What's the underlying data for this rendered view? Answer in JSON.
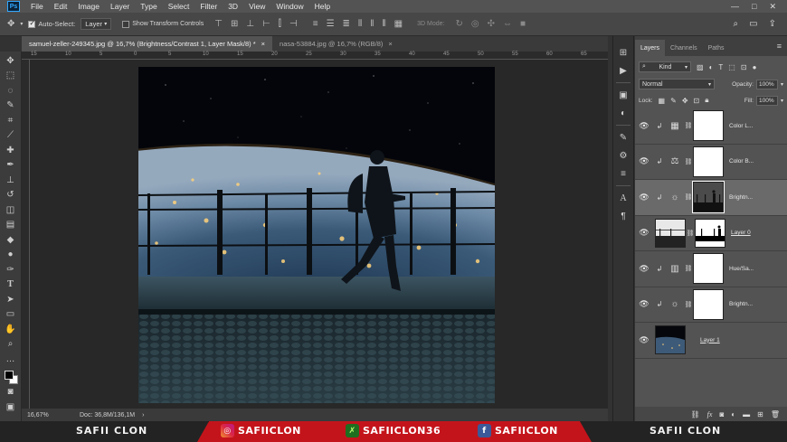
{
  "app": {
    "logo": "Ps"
  },
  "menu": [
    "File",
    "Edit",
    "Image",
    "Layer",
    "Type",
    "Select",
    "Filter",
    "3D",
    "View",
    "Window",
    "Help"
  ],
  "window_controls": [
    "—",
    "□",
    "✕"
  ],
  "options_bar": {
    "auto_select_label": "Auto-Select:",
    "auto_select_target": "Layer",
    "transform_controls_label": "Show Transform Controls",
    "mode_3d_label": "3D Mode:"
  },
  "tabs": [
    {
      "title": "samuel-zeller-249345.jpg @ 16,7% (Brightness/Contrast 1, Layer Mask/8) *",
      "close": "×"
    },
    {
      "title": "nasa-53884.jpg @ 16,7% (RGB/8)",
      "close": "×"
    }
  ],
  "ruler_top": [
    "15",
    "10",
    "5",
    "0",
    "5",
    "10",
    "15",
    "20",
    "25",
    "30",
    "35",
    "40",
    "45",
    "50",
    "55",
    "60",
    "65"
  ],
  "status": {
    "zoom": "16,67%",
    "doc": "Doc: 36,8M/136,1M",
    "arrow": "›"
  },
  "layers_panel": {
    "tabs": [
      "Layers",
      "Channels",
      "Paths"
    ],
    "kind_label": "Kind",
    "blend_mode": "Normal",
    "opacity_label": "Opacity:",
    "opacity_value": "100%",
    "lock_label": "Lock:",
    "fill_label": "Fill:",
    "fill_value": "100%",
    "layers": [
      {
        "name": "Color L...",
        "kind": "adjustment",
        "icon": "grid-icon",
        "selected": false
      },
      {
        "name": "Color B...",
        "kind": "adjustment",
        "icon": "balance-icon",
        "selected": false
      },
      {
        "name": "Brightn...",
        "kind": "adjustment",
        "icon": "sun-icon",
        "selected": true
      },
      {
        "name": "Layer 0",
        "kind": "pixel-mask",
        "selected": false
      },
      {
        "name": "Hue/Sa...",
        "kind": "adjustment",
        "icon": "hue-icon",
        "selected": false
      },
      {
        "name": "Brightn...",
        "kind": "adjustment",
        "icon": "sun-icon",
        "selected": false
      },
      {
        "name": "Layer 1",
        "kind": "pixel",
        "selected": false
      }
    ]
  },
  "banner": {
    "left_name": "SAFII CLON",
    "instagram": "SAFIICLON",
    "snapchat": "SAFIICLON36",
    "facebook": "SAFIICLON",
    "right_name": "SAFII CLON"
  },
  "colors": {
    "accent": "#31a8ff",
    "banner_red": "#c4141b"
  }
}
